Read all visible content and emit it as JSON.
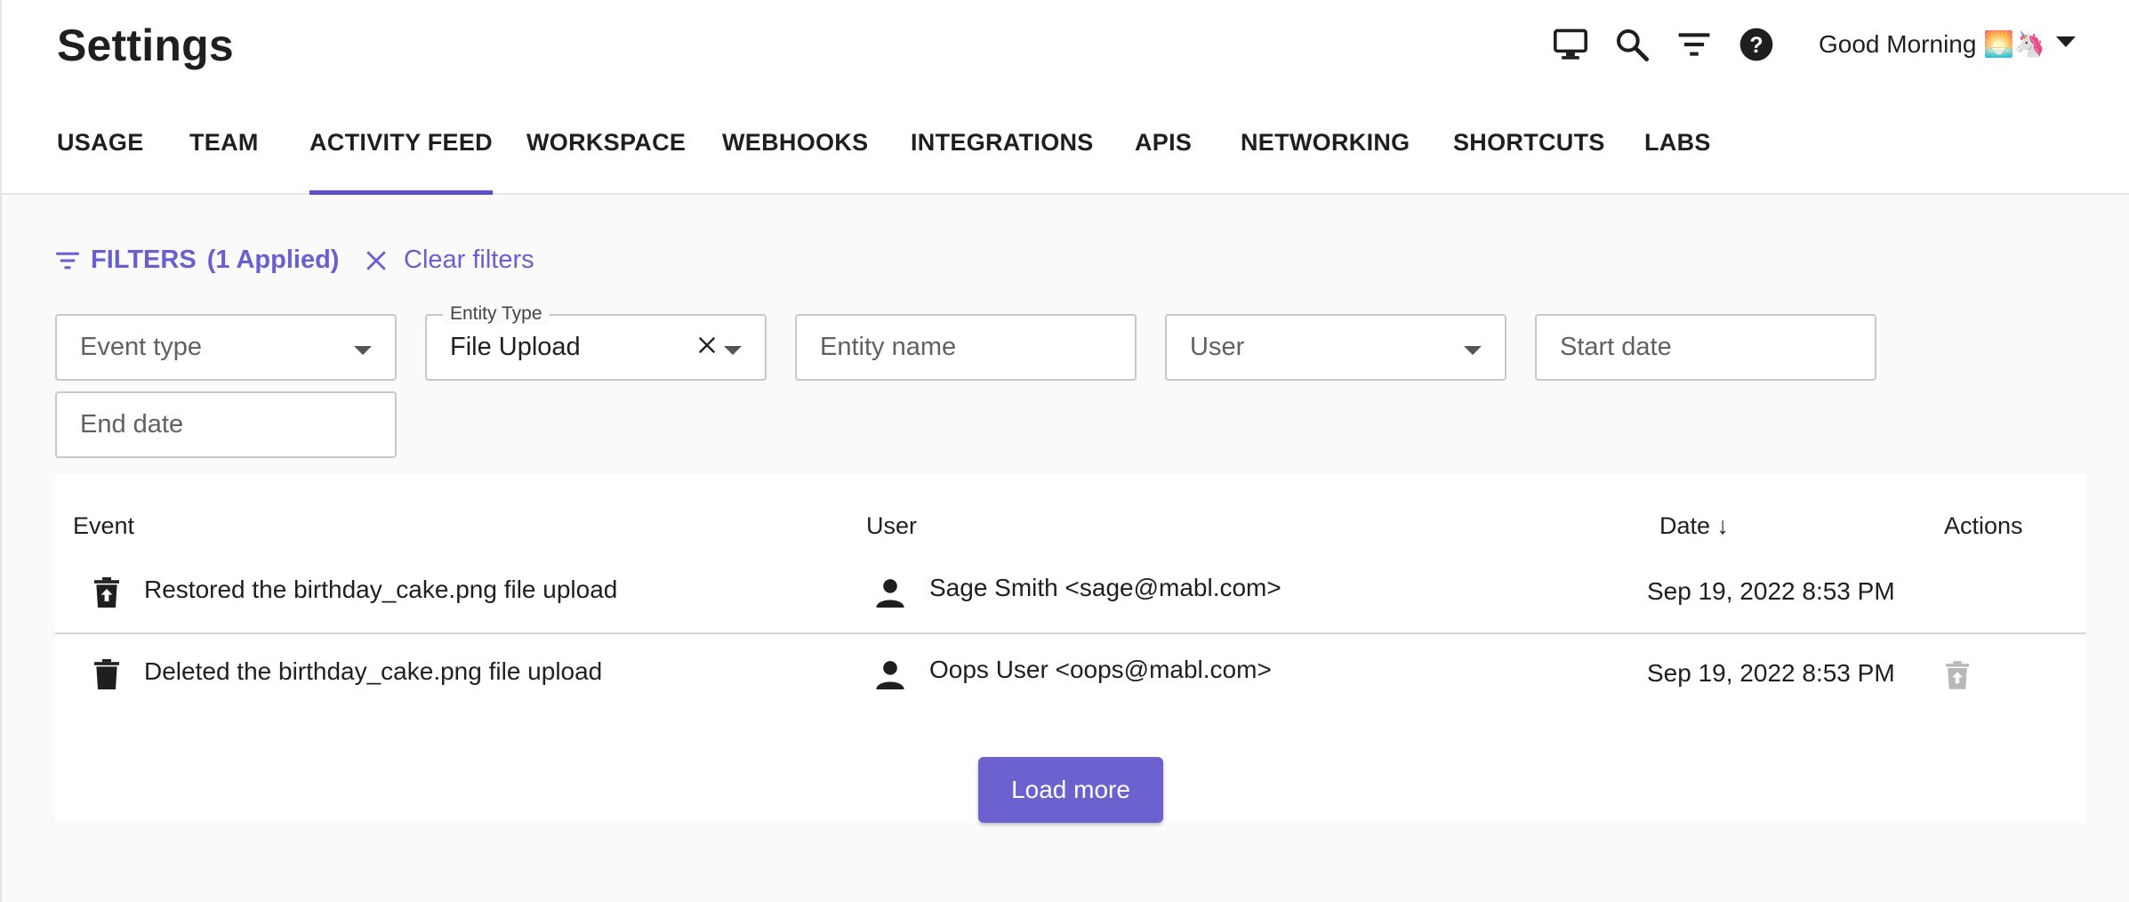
{
  "page": {
    "title": "Settings"
  },
  "header": {
    "greeting": "Good Morning 🌅🦄",
    "icons": [
      "monitor-icon",
      "search-icon",
      "filter-list-icon",
      "help-icon",
      "caret-down-icon"
    ]
  },
  "tabs": [
    {
      "label": "USAGE",
      "active": false
    },
    {
      "label": "TEAM",
      "active": false
    },
    {
      "label": "ACTIVITY FEED",
      "active": true
    },
    {
      "label": "WORKSPACE",
      "active": false
    },
    {
      "label": "WEBHOOKS",
      "active": false
    },
    {
      "label": "INTEGRATIONS",
      "active": false
    },
    {
      "label": "APIS",
      "active": false
    },
    {
      "label": "NETWORKING",
      "active": false
    },
    {
      "label": "SHORTCUTS",
      "active": false
    },
    {
      "label": "LABS",
      "active": false
    }
  ],
  "filters": {
    "label": "FILTERS",
    "applied": "(1 Applied)",
    "clear_label": "Clear filters",
    "event_type_placeholder": "Event type",
    "entity_type_legend": "Entity Type",
    "entity_type_value": "File Upload",
    "entity_name_placeholder": "Entity name",
    "user_placeholder": "User",
    "start_date_placeholder": "Start date",
    "end_date_placeholder": "End date"
  },
  "table": {
    "columns": {
      "event": "Event",
      "user": "User",
      "date": "Date ↓",
      "actions": "Actions"
    },
    "rows": [
      {
        "event": "Restored the birthday_cake.png file upload",
        "event_icon": "restore-from-trash-icon",
        "user": "Sage Smith <sage@mabl.com>",
        "user_icon": "person-icon",
        "date": "Sep 19, 2022 8:53 PM",
        "action_icon": ""
      },
      {
        "event": "Deleted the birthday_cake.png file upload",
        "event_icon": "delete-icon",
        "user": "Oops User <oops@mabl.com>",
        "user_icon": "person-icon",
        "date": "Sep 19, 2022 8:53 PM",
        "action_icon": "restore-from-trash-icon"
      }
    ],
    "load_more_label": "Load more"
  },
  "colors": {
    "accent": "#5a50c8",
    "link": "#6a5fd0",
    "button": "#6b62d0",
    "background": "#fafafa"
  }
}
